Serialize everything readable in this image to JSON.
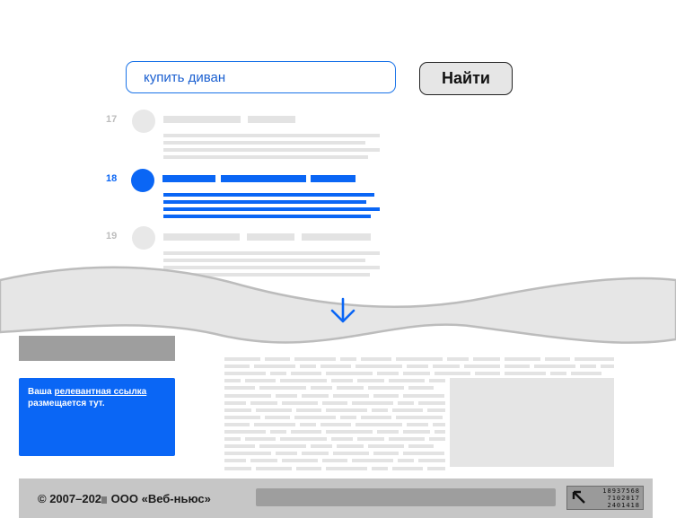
{
  "search": {
    "query": "купить диван",
    "button_label": "Найти"
  },
  "results": [
    {
      "number": "17",
      "active": false
    },
    {
      "number": "18",
      "active": true
    },
    {
      "number": "19",
      "active": false
    }
  ],
  "ad": {
    "text_before": "Ваша",
    "link_text": "релевантная ссылка",
    "text_after": "размещается тут."
  },
  "footer": {
    "copyright_prefix": "© 2007–202",
    "company": "ООО «Веб-ньюс»",
    "counter_lines": [
      "18937568",
      "7102017",
      "2401418"
    ]
  },
  "colors": {
    "accent": "#0a66f5",
    "placeholder": "#e3e3e3",
    "footer": "#c6c6c6"
  },
  "icons": {
    "scroll": "arrow-down-icon",
    "counter": "arrow-up-left-icon"
  }
}
